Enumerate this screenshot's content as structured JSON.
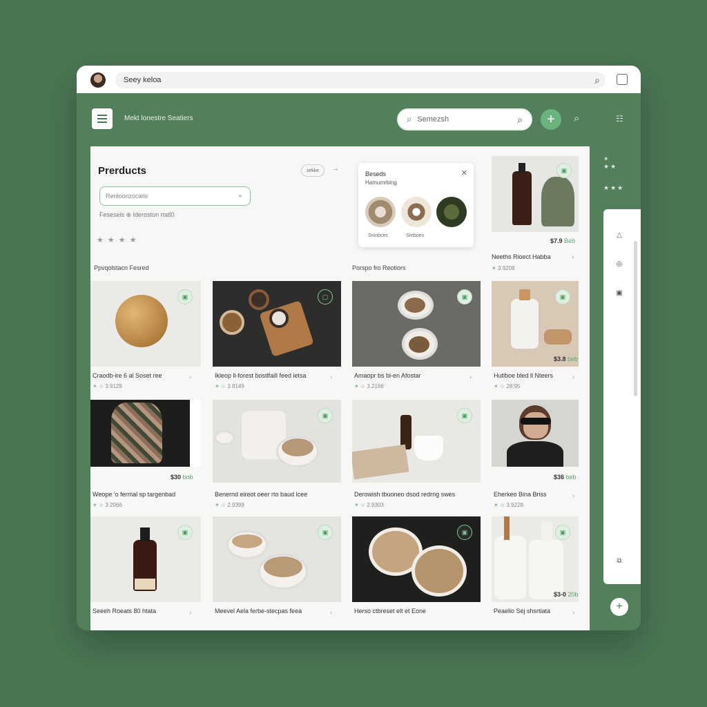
{
  "titlebar": {
    "url_text": "Seey keloa"
  },
  "header": {
    "title": "Mekt lonestre Seatiers",
    "search_placeholder": "Semezsh"
  },
  "panel": {
    "title": "Prerducts",
    "chip_label": "sekke",
    "category_value": "Reriloonzociels",
    "filter_line": "Feseseis  ⊕  Ideroston rtatl0"
  },
  "popup": {
    "title": "Beseds",
    "subtitle": "Hamumrbing",
    "labels": [
      "Sninbces",
      "Sreboes"
    ]
  },
  "side_product": {
    "price": "$7.9",
    "price_suffix": "Beb",
    "name": "Neeths Rioect Habba",
    "meta": "3.9208"
  },
  "sections": [
    "Ppvqolstacn Fesred",
    "Porspo fro Reotiors"
  ],
  "cards": [
    {
      "title": "Craodb-ire 6 al Soset ree",
      "meta": "3.9128",
      "price": "",
      "price_suffix": ""
    },
    {
      "title": "Ikleop ll-forest bostlfaill feed ietsa",
      "meta": "3 8149",
      "price": "",
      "price_suffix": ""
    },
    {
      "title": "Amaopr bs bl-en Afostar",
      "meta": "3.2166",
      "price": "",
      "price_suffix": ""
    },
    {
      "title": "Hutlboe bled ll Nteers",
      "meta": "28.95",
      "price": "$3.8",
      "price_suffix": "beb"
    },
    {
      "title": "Weope 'o fermal sp targenbad",
      "meta": "3.2066",
      "price": "$30",
      "price_suffix": "bnb"
    },
    {
      "title": "Benernd eireot oeer rto baud lcee",
      "meta": "2.9399",
      "price": "",
      "price_suffix": ""
    },
    {
      "title": "Derowish tbuoneo dsod redrng swes",
      "meta": "2.9303",
      "price": "",
      "price_suffix": ""
    },
    {
      "title": "Eherkeo Bina Briss",
      "meta": "3.9228",
      "price": "$36",
      "price_suffix": "beb"
    },
    {
      "title": "Seeeh Roeats 80 htata",
      "meta": "",
      "price": "",
      "price_suffix": ""
    },
    {
      "title": "Meevel Aela ferbe-stecpas feea",
      "meta": "",
      "price": "",
      "price_suffix": ""
    },
    {
      "title": "Herso ctbreset elt et Eone",
      "meta": "",
      "price": "",
      "price_suffix": ""
    },
    {
      "title": "Peaelio Sej shsrtiata",
      "meta": "",
      "price": "$3-0",
      "price_suffix": "20b"
    }
  ],
  "colors": {
    "background": "#4a7653",
    "accent": "#6ab27e",
    "panel": "#f7f7f6"
  }
}
